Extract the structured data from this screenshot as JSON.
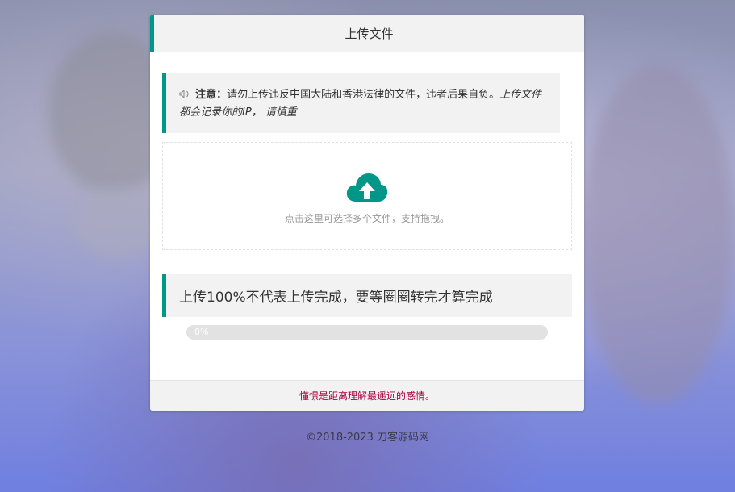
{
  "header": {
    "title": "上传文件"
  },
  "notice": {
    "icon": "speaker-icon",
    "label": "注意：",
    "text": "请勿上传违反中国大陆和香港法律的文件，违者后果自负。",
    "emphasis": "上传文件都会记录你的IP， 请慎重"
  },
  "upload": {
    "icon": "cloud-upload-icon",
    "hint": "点击这里可选择多个文件，支持拖拽。"
  },
  "tip": {
    "text": "上传100%不代表上传完成，要等圈圈转完才算完成"
  },
  "progress": {
    "value": 0,
    "label": "0%"
  },
  "footer": {
    "quote": "懂憬是距离理解最遥远的感情。"
  },
  "copyright": "©2018-2023 刀客源码网",
  "colors": {
    "accent": "#009688",
    "footer_text": "#a5003a"
  }
}
